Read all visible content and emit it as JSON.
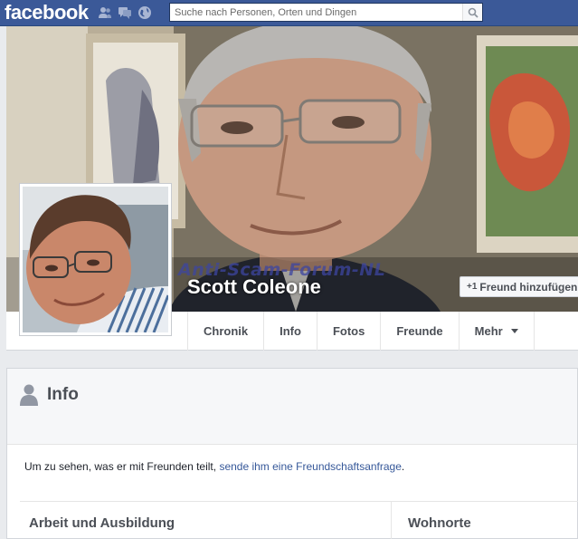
{
  "topbar": {
    "logo": "facebook",
    "search_placeholder": "Suche nach Personen, Orten und Dingen",
    "icons": [
      "friend-requests-icon",
      "messages-icon",
      "notifications-globe-icon"
    ]
  },
  "cover": {
    "watermark": "Anti-Scam-Forum-NL"
  },
  "profile": {
    "name": "Scott Coleone",
    "add_friend_label": "Freund hinzufügen"
  },
  "tabs": [
    {
      "label": "Chronik"
    },
    {
      "label": "Info"
    },
    {
      "label": "Fotos"
    },
    {
      "label": "Freunde"
    },
    {
      "label": "Mehr"
    }
  ],
  "info": {
    "title": "Info",
    "message_prefix": "Um zu sehen, was er mit Freunden teilt,",
    "message_link": "sende ihm eine Freundschaftsanfrage",
    "message_suffix": ".",
    "section_left": "Arbeit und Ausbildung",
    "section_right": "Wohnorte"
  },
  "colors": {
    "brand": "#3b5998",
    "link": "#365899"
  }
}
